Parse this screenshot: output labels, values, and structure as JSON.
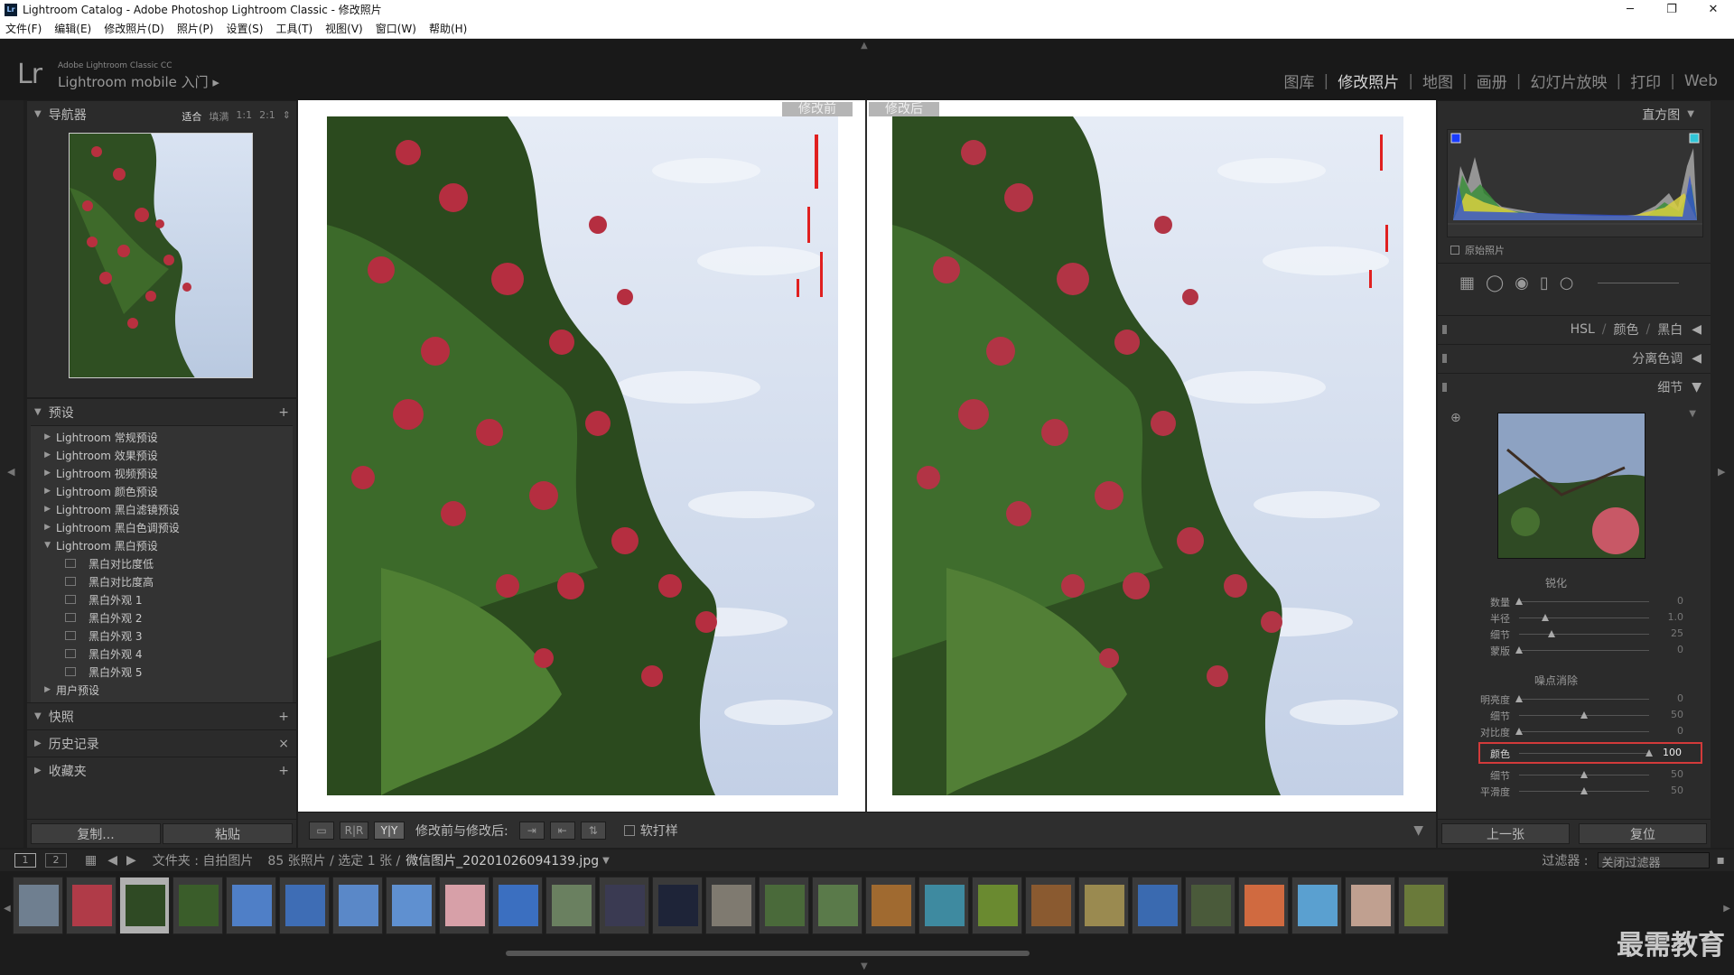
{
  "window": {
    "title": "Lightroom Catalog - Adobe Photoshop Lightroom Classic - 修改照片",
    "app_icon": "Lr",
    "controls": [
      "─",
      "❐",
      "✕"
    ]
  },
  "menu": [
    "文件(F)",
    "编辑(E)",
    "修改照片(D)",
    "照片(P)",
    "设置(S)",
    "工具(T)",
    "视图(V)",
    "窗口(W)",
    "帮助(H)"
  ],
  "header": {
    "logo": "Lr",
    "brand_small": "Adobe Lightroom Classic CC",
    "brand_big": "Lightroom mobile 入门 ▸",
    "modules": [
      "图库",
      "修改照片",
      "地图",
      "画册",
      "幻灯片放映",
      "打印",
      "Web"
    ],
    "active_module": "修改照片"
  },
  "left_panel": {
    "navigator": {
      "title": "导航器",
      "zoom": [
        "适合",
        "填满",
        "1:1",
        "2:1"
      ],
      "selected_zoom": "适合"
    },
    "presets": {
      "title": "预设",
      "groups": [
        "Lightroom 常规预设",
        "Lightroom 效果预设",
        "Lightroom 视频预设",
        "Lightroom 颜色预设",
        "Lightroom 黑白滤镜预设",
        "Lightroom 黑白色调预设",
        "Lightroom 黑白预设"
      ],
      "expanded_items": [
        "黑白对比度低",
        "黑白对比度高",
        "黑白外观 1",
        "黑白外观 2",
        "黑白外观 3",
        "黑白外观 4",
        "黑白外观 5"
      ],
      "user_presets": "用户预设"
    },
    "snapshots": "快照",
    "history": "历史记录",
    "collections": "收藏夹",
    "copy_button": "复制...",
    "paste_button": "粘贴"
  },
  "center": {
    "before_label": "修改前",
    "after_label": "修改后"
  },
  "toolbar": {
    "view_label": "修改前与修改后:",
    "soft_proof": "软打样"
  },
  "right_panel": {
    "histogram_title": "直方图",
    "original_photo": "原始照片",
    "hsl": {
      "hsl": "HSL",
      "color": "颜色",
      "bw": "黑白"
    },
    "split_toning": "分离色调",
    "detail": "细节",
    "sharpening": {
      "title": "锐化",
      "sliders": [
        {
          "label": "数量",
          "value": "0",
          "pos": 0.0
        },
        {
          "label": "半径",
          "value": "1.0",
          "pos": 0.2
        },
        {
          "label": "细节",
          "value": "25",
          "pos": 0.25
        },
        {
          "label": "蒙版",
          "value": "0",
          "pos": 0.0
        }
      ]
    },
    "noise_reduction": {
      "title": "噪点消除",
      "sliders": [
        {
          "label": "明亮度",
          "value": "0",
          "pos": 0.0
        },
        {
          "label": "细节",
          "value": "50",
          "pos": 0.5
        },
        {
          "label": "对比度",
          "value": "0",
          "pos": 0.0
        },
        {
          "label": "颜色",
          "value": "100",
          "pos": 1.0,
          "highlight": true
        },
        {
          "label": "细节",
          "value": "50",
          "pos": 0.5
        },
        {
          "label": "平滑度",
          "value": "50",
          "pos": 0.5
        }
      ]
    },
    "prev_button": "上一张",
    "reset_button": "复位"
  },
  "filmbar": {
    "pages": [
      "1",
      "2"
    ],
    "folder": "文件夹 : 自拍图片",
    "count": "85 张照片 / 选定 1 张 /",
    "filename": "微信图片_20201026094139.jpg",
    "filter_label": "过滤器 :",
    "filter_value": "关闭过滤器"
  },
  "filmstrip": {
    "thumbnails": 27,
    "selected_index": 2
  },
  "watermark": "最需教育",
  "colors": {
    "accent_red": "#d23a3a",
    "panel": "#2b2b2b",
    "bg": "#1e1e1e"
  }
}
